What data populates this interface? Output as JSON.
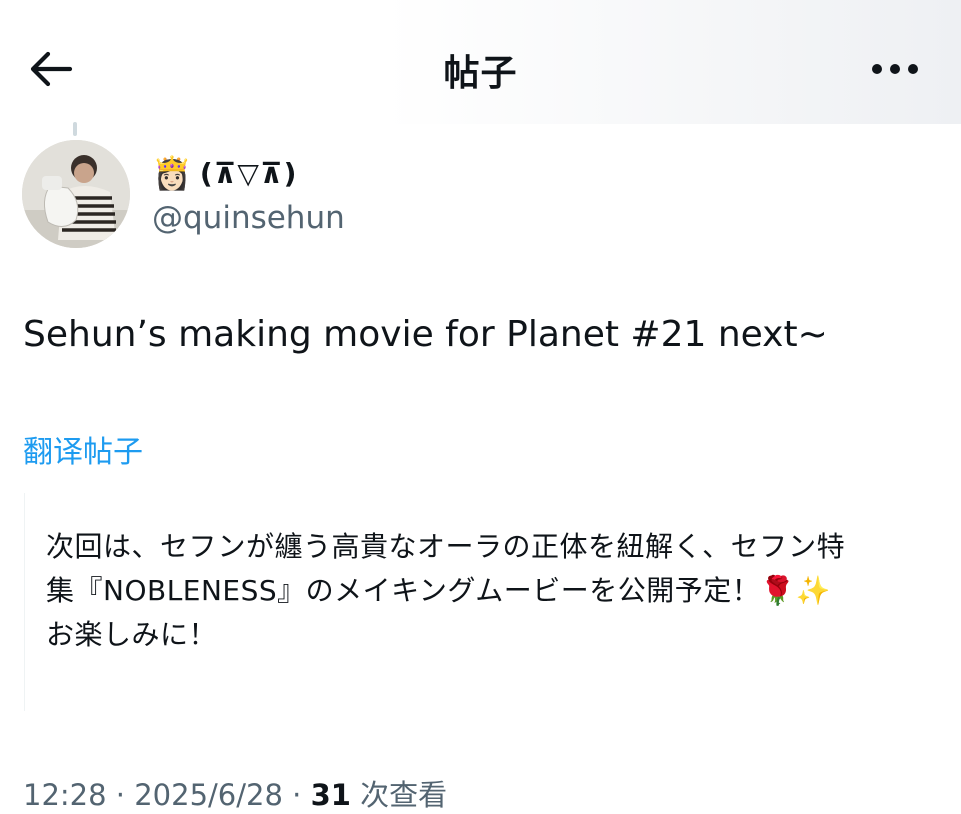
{
  "header": {
    "title": "帖子",
    "back_icon": "arrow-left-icon",
    "more_icon": "more-horizontal-icon"
  },
  "author": {
    "display_emoji": "👸🏻",
    "display_name": "(⊼▽⊼)",
    "handle": "@quinsehun",
    "avatar_icon": "user-avatar"
  },
  "tweet": {
    "text": "Sehun’s making movie for Planet #21 next~",
    "translate_label": "翻译帖子"
  },
  "translation": {
    "lines": [
      "次回は、セフンが纏う高貴なオーラの正体を紐解く、セフン特",
      "集『NOBLENESS』のメイキングムービーを公開予定！🌹✨",
      "お楽しみに！"
    ]
  },
  "meta": {
    "time": "12:28",
    "date": "2025/6/28",
    "separator": " · ",
    "views_count": "31",
    "views_label": " 次查看"
  },
  "colors": {
    "accent": "#1d9bf0",
    "text": "#0f1419",
    "secondary": "#536471"
  }
}
